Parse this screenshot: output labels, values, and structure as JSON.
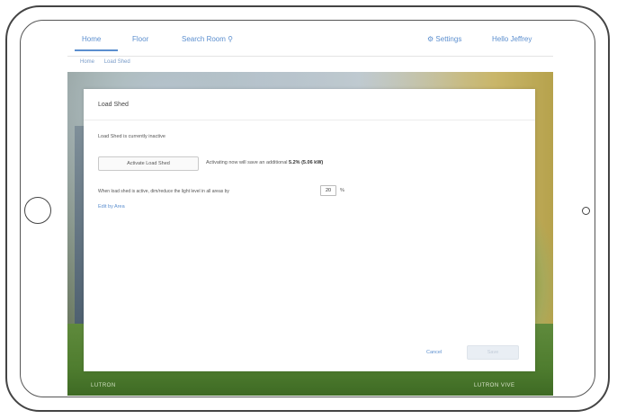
{
  "nav": {
    "home": "Home",
    "floor": "Floor",
    "search": "Search Room",
    "settings": "Settings",
    "user": "Hello Jeffrey"
  },
  "breadcrumb": {
    "home": "Home",
    "current": "Load Shed"
  },
  "dialog": {
    "title": "Load Shed",
    "status": "Load Shed is currently inactive",
    "activate_button": "Activate Load Shed",
    "savings_prefix": "Activating now will save an additional",
    "savings_value": "5.2% (5.06 kW)",
    "dim_label": "When load shed is active, dim/reduce the light level in all areas by",
    "dim_value": "20",
    "dim_unit": "%",
    "edit_link": "Edit by Area",
    "cancel": "Cancel",
    "save": "Save"
  },
  "footer": {
    "brand": "LUTRON",
    "right": "LUTRON VIVE"
  }
}
